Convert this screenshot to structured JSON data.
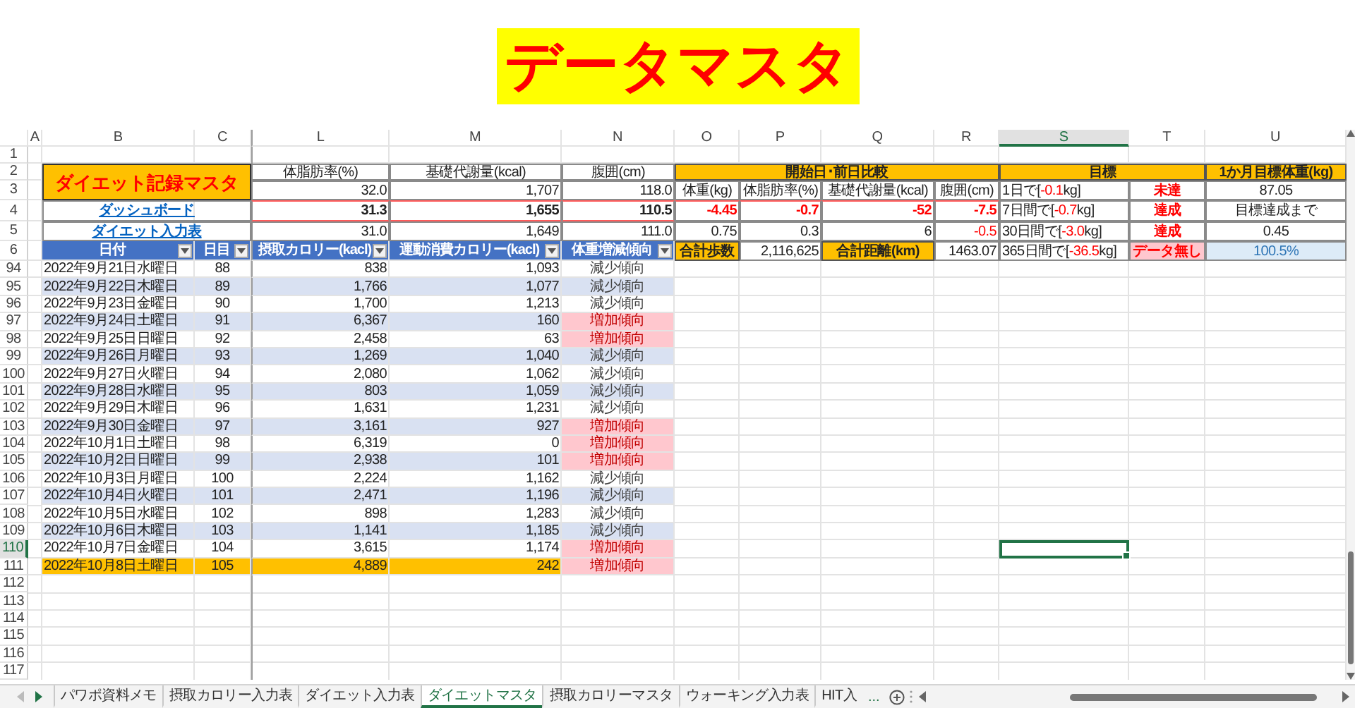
{
  "banner": {
    "title": "データマスタ"
  },
  "column_headers": [
    {
      "label": "A",
      "selected": false
    },
    {
      "label": "B",
      "selected": false
    },
    {
      "label": "C",
      "selected": false
    },
    {
      "label": "L",
      "selected": false
    },
    {
      "label": "M",
      "selected": false
    },
    {
      "label": "N",
      "selected": false
    },
    {
      "label": "O",
      "selected": false
    },
    {
      "label": "P",
      "selected": false
    },
    {
      "label": "Q",
      "selected": false
    },
    {
      "label": "R",
      "selected": false
    },
    {
      "label": "S",
      "selected": true
    },
    {
      "label": "T",
      "selected": false
    },
    {
      "label": "U",
      "selected": false
    }
  ],
  "row_numbers": [
    {
      "label": "1",
      "selected": false
    },
    {
      "label": "2",
      "selected": false
    },
    {
      "label": "3",
      "selected": false
    },
    {
      "label": "4",
      "selected": false
    },
    {
      "label": "5",
      "selected": false
    },
    {
      "label": "6",
      "selected": false
    },
    {
      "label": "94",
      "selected": false
    },
    {
      "label": "95",
      "selected": false
    },
    {
      "label": "96",
      "selected": false
    },
    {
      "label": "97",
      "selected": false
    },
    {
      "label": "98",
      "selected": false
    },
    {
      "label": "99",
      "selected": false
    },
    {
      "label": "100",
      "selected": false
    },
    {
      "label": "101",
      "selected": false
    },
    {
      "label": "102",
      "selected": false
    },
    {
      "label": "103",
      "selected": false
    },
    {
      "label": "104",
      "selected": false
    },
    {
      "label": "105",
      "selected": false
    },
    {
      "label": "106",
      "selected": false
    },
    {
      "label": "107",
      "selected": false
    },
    {
      "label": "108",
      "selected": false
    },
    {
      "label": "109",
      "selected": false
    },
    {
      "label": "110",
      "selected": true
    },
    {
      "label": "111",
      "selected": false
    },
    {
      "label": "112",
      "selected": false
    },
    {
      "label": "113",
      "selected": false
    },
    {
      "label": "114",
      "selected": false
    },
    {
      "label": "115",
      "selected": false
    },
    {
      "label": "116",
      "selected": false
    },
    {
      "label": "117",
      "selected": false
    }
  ],
  "master": {
    "title": "ダイエット記録マスタ",
    "links": [
      "ダッシュボード",
      "ダイエット入力表"
    ]
  },
  "body_metrics": {
    "headers": [
      "体脂肪率(%)",
      "基礎代謝量(kcal)",
      "腹囲(cm)"
    ],
    "rows": [
      {
        "values": [
          "32.0",
          "1,707",
          "118.0"
        ],
        "bold": false
      },
      {
        "values": [
          "31.3",
          "1,655",
          "110.5"
        ],
        "bold": true
      },
      {
        "values": [
          "31.0",
          "1,649",
          "111.0"
        ],
        "bold": false
      }
    ]
  },
  "comparison": {
    "title": "開始日･前日比較",
    "headers": [
      "体重(kg)",
      "体脂肪率(%)",
      "基礎代謝量(kcal)",
      "腹囲(cm)"
    ],
    "rows": [
      {
        "bold": true,
        "values": [
          {
            "text": "-4.45",
            "negative": true
          },
          {
            "text": "-0.7",
            "negative": true
          },
          {
            "text": "-52",
            "negative": true
          },
          {
            "text": "-7.5",
            "negative": true
          }
        ]
      },
      {
        "bold": false,
        "values": [
          {
            "text": "0.75",
            "negative": false
          },
          {
            "text": "0.3",
            "negative": false
          },
          {
            "text": "6",
            "negative": false
          },
          {
            "text": "-0.5",
            "negative": true
          }
        ]
      }
    ]
  },
  "totals": [
    {
      "label": "合計歩数",
      "value": "2,116,625"
    },
    {
      "label": "合計距離(km)",
      "value": "1463.07"
    }
  ],
  "goals": {
    "title": "目標",
    "items": [
      {
        "before": "1日で[",
        "amount": "-0.1",
        "after": "kg]",
        "status": "未達",
        "kind": "result"
      },
      {
        "before": "7日間で[",
        "amount": "-0.7",
        "after": "kg]",
        "status": "達成",
        "kind": "result"
      },
      {
        "before": "30日間で[",
        "amount": "-3.0",
        "after": "kg]",
        "status": "達成",
        "kind": "result"
      },
      {
        "before": "365日間で[",
        "amount": "-36.5",
        "after": "kg]",
        "status": "データ無し",
        "kind": "missing"
      }
    ]
  },
  "monthly_target": {
    "title": "1か月目標体重(kg)",
    "items": [
      {
        "text": "87.05",
        "kind": "value"
      },
      {
        "text": "目標達成まで",
        "kind": "value"
      },
      {
        "text": "0.45",
        "kind": "value"
      },
      {
        "text": "100.5%",
        "kind": "progress"
      }
    ]
  },
  "table": {
    "columns": [
      {
        "label": "日付",
        "filter": true
      },
      {
        "label": "日目",
        "filter": true
      },
      {
        "label": "摂取カロリー(kacl)",
        "filter": true
      },
      {
        "label": "運動消費カロリー(kacl)",
        "filter": true
      },
      {
        "label": "体重増減傾向",
        "filter": true
      }
    ],
    "rows": [
      {
        "date": "2022年9月21日水曜日",
        "day": "88",
        "intake": "838",
        "burned": "1,093",
        "trend": "減少傾向",
        "increasing": false,
        "highlighted": false
      },
      {
        "date": "2022年9月22日木曜日",
        "day": "89",
        "intake": "1,766",
        "burned": "1,077",
        "trend": "減少傾向",
        "increasing": false,
        "highlighted": false
      },
      {
        "date": "2022年9月23日金曜日",
        "day": "90",
        "intake": "1,700",
        "burned": "1,213",
        "trend": "減少傾向",
        "increasing": false,
        "highlighted": false
      },
      {
        "date": "2022年9月24日土曜日",
        "day": "91",
        "intake": "6,367",
        "burned": "160",
        "trend": "増加傾向",
        "increasing": true,
        "highlighted": false
      },
      {
        "date": "2022年9月25日日曜日",
        "day": "92",
        "intake": "2,458",
        "burned": "63",
        "trend": "増加傾向",
        "increasing": true,
        "highlighted": false
      },
      {
        "date": "2022年9月26日月曜日",
        "day": "93",
        "intake": "1,269",
        "burned": "1,040",
        "trend": "減少傾向",
        "increasing": false,
        "highlighted": false
      },
      {
        "date": "2022年9月27日火曜日",
        "day": "94",
        "intake": "2,080",
        "burned": "1,062",
        "trend": "減少傾向",
        "increasing": false,
        "highlighted": false
      },
      {
        "date": "2022年9月28日水曜日",
        "day": "95",
        "intake": "803",
        "burned": "1,059",
        "trend": "減少傾向",
        "increasing": false,
        "highlighted": false
      },
      {
        "date": "2022年9月29日木曜日",
        "day": "96",
        "intake": "1,631",
        "burned": "1,231",
        "trend": "減少傾向",
        "increasing": false,
        "highlighted": false
      },
      {
        "date": "2022年9月30日金曜日",
        "day": "97",
        "intake": "3,161",
        "burned": "927",
        "trend": "増加傾向",
        "increasing": true,
        "highlighted": false
      },
      {
        "date": "2022年10月1日土曜日",
        "day": "98",
        "intake": "6,319",
        "burned": "0",
        "trend": "増加傾向",
        "increasing": true,
        "highlighted": false
      },
      {
        "date": "2022年10月2日日曜日",
        "day": "99",
        "intake": "2,938",
        "burned": "101",
        "trend": "増加傾向",
        "increasing": true,
        "highlighted": false
      },
      {
        "date": "2022年10月3日月曜日",
        "day": "100",
        "intake": "2,224",
        "burned": "1,162",
        "trend": "減少傾向",
        "increasing": false,
        "highlighted": false
      },
      {
        "date": "2022年10月4日火曜日",
        "day": "101",
        "intake": "2,471",
        "burned": "1,196",
        "trend": "減少傾向",
        "increasing": false,
        "highlighted": false
      },
      {
        "date": "2022年10月5日水曜日",
        "day": "102",
        "intake": "898",
        "burned": "1,283",
        "trend": "減少傾向",
        "increasing": false,
        "highlighted": false
      },
      {
        "date": "2022年10月6日木曜日",
        "day": "103",
        "intake": "1,141",
        "burned": "1,185",
        "trend": "減少傾向",
        "increasing": false,
        "highlighted": false
      },
      {
        "date": "2022年10月7日金曜日",
        "day": "104",
        "intake": "3,615",
        "burned": "1,174",
        "trend": "増加傾向",
        "increasing": true,
        "highlighted": false
      },
      {
        "date": "2022年10月8日土曜日",
        "day": "105",
        "intake": "4,889",
        "burned": "242",
        "trend": "増加傾向",
        "increasing": true,
        "highlighted": true
      }
    ]
  },
  "sheet_tabs": [
    {
      "label": "パワポ資料メモ",
      "selected": false
    },
    {
      "label": "摂取カロリー入力表",
      "selected": false
    },
    {
      "label": "ダイエット入力表",
      "selected": false
    },
    {
      "label": "ダイエットマスタ",
      "selected": true
    },
    {
      "label": "摂取カロリーマスタ",
      "selected": false
    },
    {
      "label": "ウォーキング入力表",
      "selected": false
    },
    {
      "label": "HIT入",
      "selected": false
    }
  ],
  "more_tabs": "..."
}
